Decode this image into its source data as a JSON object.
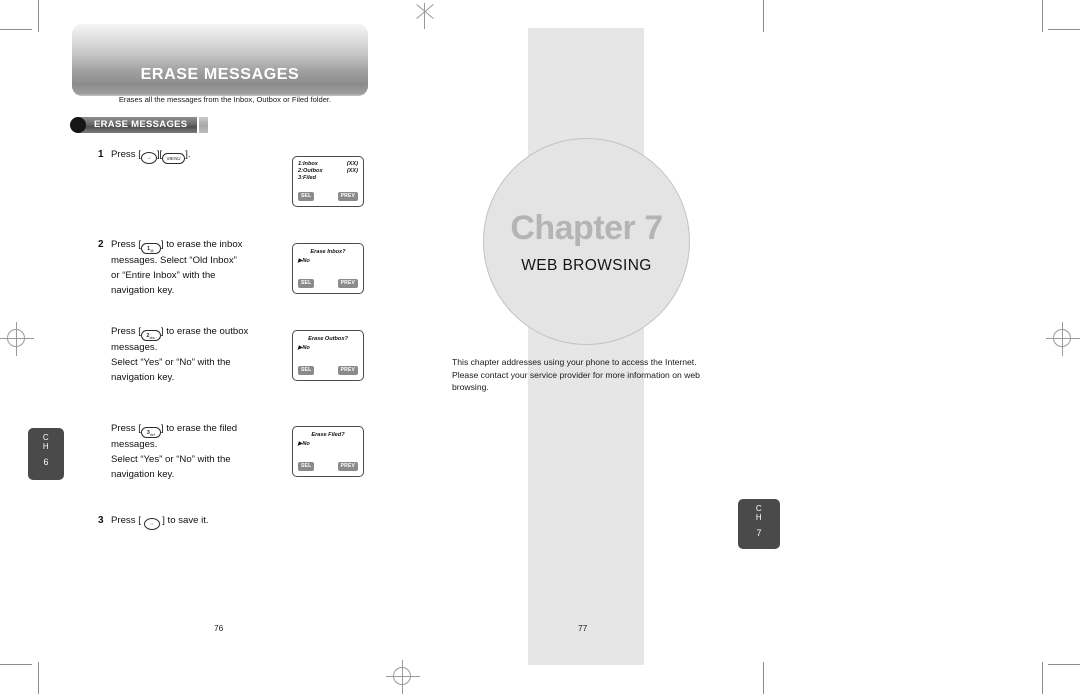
{
  "document": {
    "left_page": {
      "banner_title": "ERASE MESSAGES",
      "subtitle": "Erases all the messages from the Inbox, Outbox or Filed folder.",
      "section_badge": "ERASE MESSAGES",
      "page_number": "76",
      "chapter_tab": {
        "ch": "C",
        "h": "H",
        "number": "6"
      },
      "steps": [
        {
          "number": "1",
          "text_before": "Press [",
          "key1": "nav-key",
          "mid": "][",
          "key2_label": "MENU",
          "text_after": "].",
          "lines": []
        },
        {
          "number": "2",
          "key_number": "1",
          "key_sub": "@.",
          "lines": [
            "Press [1] to erase the inbox",
            "messages. Select “Old Inbox”",
            "or “Entire Inbox” with the",
            "navigation key."
          ]
        },
        {
          "number": "",
          "key_number": "2",
          "key_sub": "abc",
          "lines": [
            "Press [2] to erase the outbox",
            "messages.",
            "Select “Yes” or “No” with the",
            "navigation key."
          ]
        },
        {
          "number": "",
          "key_number": "3",
          "key_sub": "def",
          "lines": [
            "Press [3] to erase the filed",
            "messages.",
            "Select “Yes” or “No” with the",
            "navigation key."
          ]
        },
        {
          "number": "3",
          "lines": [
            "Press [ ] to save it."
          ]
        }
      ],
      "step1": {
        "number": "1",
        "pre": "Press [",
        "mid": "][",
        "post": "]."
      },
      "step2": {
        "number": "2",
        "pre": "Press [",
        "post": "] to erase the inbox",
        "line2": "messages. Select “Old Inbox”",
        "line3": "or “Entire Inbox” with the",
        "line4": "navigation key.",
        "key_digit": "1",
        "key_letters": "@."
      },
      "step3": {
        "pre": "Press [",
        "post": "] to erase the outbox",
        "line2": "messages.",
        "line3": "Select “Yes” or “No” with the",
        "line4": "navigation key.",
        "key_digit": "2",
        "key_letters": "abc"
      },
      "step4": {
        "pre": "Press [",
        "post": "] to erase the filed",
        "line2": "messages.",
        "line3": "Select “Yes” or “No” with the",
        "line4": "navigation key.",
        "key_digit": "3",
        "key_letters": "def"
      },
      "step5": {
        "number": "3",
        "pre": "Press [",
        "post": "] to save it."
      },
      "keys": {
        "nav_glyph": "··",
        "menu_label": "MENU"
      },
      "lcd_screens": [
        {
          "name": "message-folders",
          "kind": "list",
          "rows": [
            {
              "left": "1:Inbox",
              "right": "(XX)"
            },
            {
              "left": "2:Outbox",
              "right": "(XX)"
            },
            {
              "left": "3:Filed",
              "right": ""
            }
          ],
          "softkey_left": "SEL",
          "softkey_right": "PREV"
        },
        {
          "name": "erase-inbox-prompt",
          "kind": "prompt",
          "title": "Erase Inbox?",
          "option": "No",
          "softkey_left": "SEL",
          "softkey_right": "PREV"
        },
        {
          "name": "erase-outbox-prompt",
          "kind": "prompt",
          "title": "Erase Outbox?",
          "option": "No",
          "softkey_left": "SEL",
          "softkey_right": "PREV"
        },
        {
          "name": "erase-filed-prompt",
          "kind": "prompt",
          "title": "Erase Filed?",
          "option": "No",
          "softkey_left": "SEL",
          "softkey_right": "PREV"
        }
      ]
    },
    "right_page": {
      "chapter_word": "Chapter 7",
      "chapter_subtitle": "WEB BROWSING",
      "description": "This chapter addresses using your phone to access the Internet. Please contact your service provider for more information on web browsing.",
      "page_number": "77",
      "chapter_tab": {
        "ch": "C",
        "h": "H",
        "number": "7"
      }
    }
  },
  "colors": {
    "panel_gray": "#e6e6e6",
    "tab_gray": "#4a4a4a",
    "chapter_text": "#b4b4b4",
    "softkey": "#8b8b8b"
  }
}
